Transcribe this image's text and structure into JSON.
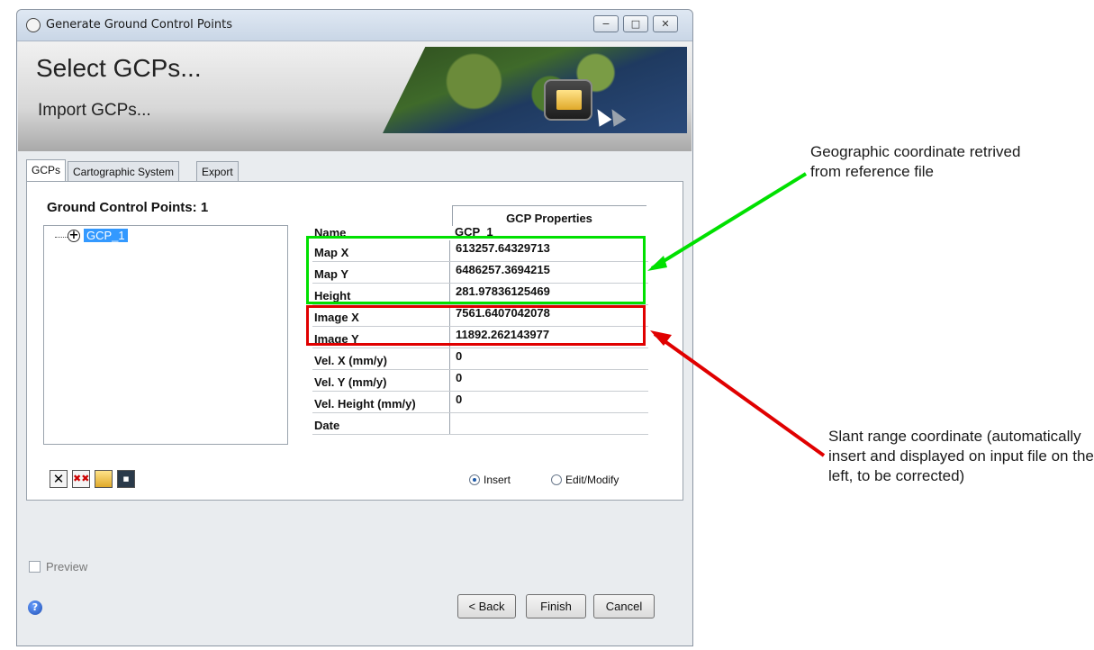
{
  "window": {
    "title": "Generate Ground Control Points",
    "controls": {
      "minimize": "−",
      "maximize": "□",
      "close": "✕"
    }
  },
  "header": {
    "title": "Select GCPs...",
    "subtitle": "Import GCPs..."
  },
  "tabs": [
    {
      "label": "GCPs",
      "active": true
    },
    {
      "label": "Cartographic System",
      "active": false
    },
    {
      "label": "Export",
      "active": false
    }
  ],
  "gcp_panel": {
    "heading": "Ground Control Points:",
    "count": "1",
    "tree_items": [
      {
        "label": "GCP_1",
        "selected": true
      }
    ]
  },
  "properties": {
    "heading": "GCP Properties",
    "rows": [
      {
        "key": "Name",
        "value": "GCP_1"
      },
      {
        "key": "Map X",
        "value": "613257.64329713"
      },
      {
        "key": "Map Y",
        "value": "6486257.3694215"
      },
      {
        "key": "Height",
        "value": "281.97836125469"
      },
      {
        "key": "Image X",
        "value": "7561.6407042078"
      },
      {
        "key": "Image Y",
        "value": "11892.262143977"
      },
      {
        "key": "Vel. X (mm/y)",
        "value": "0"
      },
      {
        "key": "Vel. Y (mm/y)",
        "value": "0"
      },
      {
        "key": "Vel. Height (mm/y)",
        "value": "0"
      },
      {
        "key": "Date",
        "value": ""
      }
    ]
  },
  "toolbar": {
    "delete_icon": "delete-icon",
    "delete_all_icon": "delete-all-icon",
    "open_icon": "folder-open-icon",
    "save_icon": "save-icon"
  },
  "mode": {
    "insert_label": "Insert",
    "edit_label": "Edit/Modify",
    "selected": "Insert"
  },
  "preview": {
    "label": "Preview",
    "checked": false,
    "enabled": false
  },
  "buttons": {
    "back": "< Back",
    "finish": "Finish",
    "cancel": "Cancel"
  },
  "annotations": {
    "geographic": "Geographic coordinate retrived from reference file",
    "slant": "Slant range coordinate (automatically insert and displayed on input file on the left, to be corrected)",
    "green_color": "#00e000",
    "red_color": "#e00000"
  }
}
